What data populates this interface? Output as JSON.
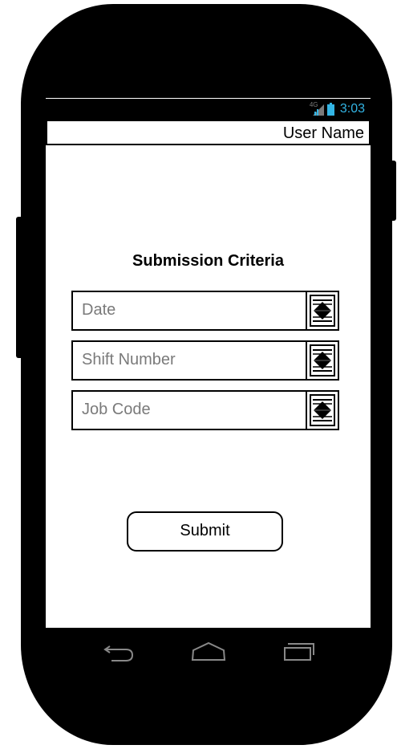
{
  "status_bar": {
    "network_label": "4G",
    "time": "3:03",
    "accent_color": "#33b5e5"
  },
  "header": {
    "user_name": "User Name"
  },
  "form": {
    "title": "Submission Criteria",
    "fields": [
      {
        "placeholder": "Date",
        "picker_icon": "spinner-picker-icon"
      },
      {
        "placeholder": "Shift Number",
        "picker_icon": "spinner-picker-icon"
      },
      {
        "placeholder": "Job Code",
        "picker_icon": "spinner-picker-icon"
      }
    ],
    "submit_label": "Submit"
  },
  "navigation": {
    "icons": [
      "back-icon",
      "home-icon",
      "recent-apps-icon"
    ]
  }
}
